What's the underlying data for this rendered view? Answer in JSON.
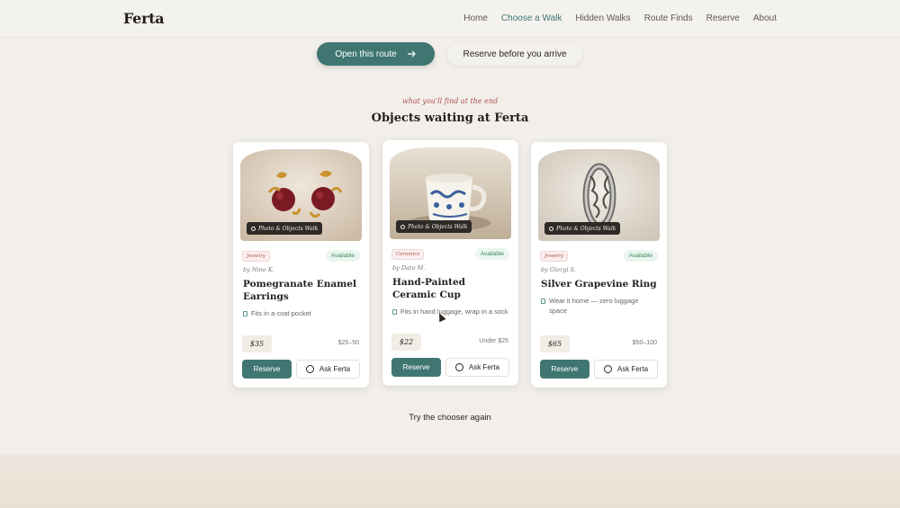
{
  "brand": "Ferta",
  "nav": [
    "Home",
    "Choose a Walk",
    "Hidden Walks",
    "Route Finds",
    "Reserve",
    "About"
  ],
  "nav_active": "Choose a Walk",
  "cta": {
    "primary": "Open this route",
    "secondary": "Reserve before you arrive"
  },
  "section": {
    "eyebrow": "what you'll find at the end",
    "title": "Objects waiting at Ferta"
  },
  "cards": [
    {
      "walk_tag": "Photo & Objects Walk",
      "category": "Jewelry",
      "status": "Available",
      "maker": "by Nino K.",
      "name": "Pomegranate Enamel Earrings",
      "note": "Fits in a coat pocket",
      "price": "$35",
      "range": "$25–50",
      "reserve": "Reserve",
      "ask": "Ask Ferta"
    },
    {
      "walk_tag": "Photo & Objects Walk",
      "category": "Ceramics",
      "status": "Available",
      "maker": "by Dato M.",
      "name": "Hand-Painted Ceramic Cup",
      "note": "Fits in hand luggage, wrap in a sock",
      "price": "$22",
      "range": "Under $25",
      "reserve": "Reserve",
      "ask": "Ask Ferta"
    },
    {
      "walk_tag": "Photo & Objects Walk",
      "category": "Jewelry",
      "status": "Available",
      "maker": "by Giorgi S.",
      "name": "Silver Grapevine Ring",
      "note": "Wear it home — zero luggage space",
      "price": "$65",
      "range": "$50–100",
      "reserve": "Reserve",
      "ask": "Ask Ferta"
    }
  ],
  "try_again": "Try the chooser again",
  "icons": [
    "arrow-right-icon",
    "pin-icon",
    "luggage-icon",
    "chat-icon"
  ],
  "colors": {
    "accent": "#3f7672",
    "available": "#3f8a60",
    "category": "#b25552"
  }
}
